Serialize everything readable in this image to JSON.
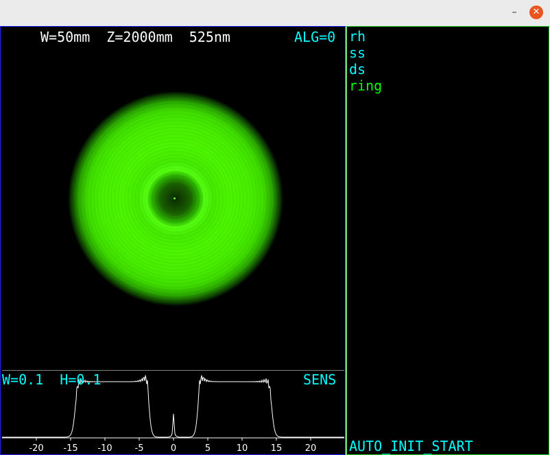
{
  "window": {
    "minimize_glyph": "–",
    "close_glyph": "✕"
  },
  "header": {
    "params": "W=50mm  Z=2000mm  525nm",
    "alg": "ALG=0"
  },
  "plot": {
    "left_label": "W=0.1  H=0.1",
    "right_label": "SENS",
    "ticks": [
      "-20",
      "-15",
      "-10",
      "-5",
      "0",
      "5",
      "10",
      "15",
      "20"
    ]
  },
  "commands": [
    {
      "label": "rh",
      "color": "#00ffff"
    },
    {
      "label": "ss",
      "color": "#00ffff"
    },
    {
      "label": "ds",
      "color": "#00ffff"
    },
    {
      "label": "ring",
      "color": "#00ff00"
    }
  ],
  "status": "AUTO_INIT_START",
  "colors": {
    "beam": "#47ee00",
    "text_primary": "#00ffff",
    "frame_left": "#2020ff",
    "frame_right": "#20d020"
  }
}
